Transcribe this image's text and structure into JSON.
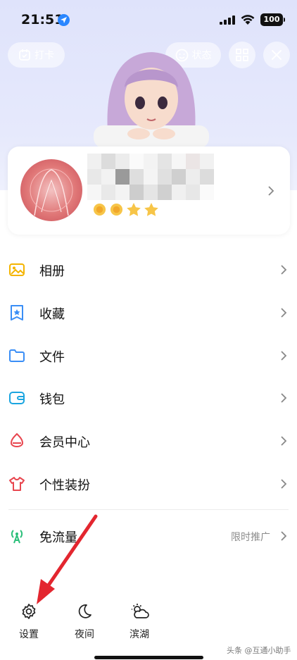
{
  "status_bar": {
    "time": "21:51",
    "battery": "100"
  },
  "top_actions": {
    "checkin_label": "打卡",
    "status_label": "状态"
  },
  "profile": {
    "stars": [
      "sun",
      "sun",
      "star",
      "star"
    ]
  },
  "menu": [
    {
      "label": "相册",
      "icon": "album-icon",
      "color": "#f4b400"
    },
    {
      "label": "收藏",
      "icon": "favorite-icon",
      "color": "#3a8ef6"
    },
    {
      "label": "文件",
      "icon": "folder-icon",
      "color": "#3a8ef6"
    },
    {
      "label": "钱包",
      "icon": "wallet-icon",
      "color": "#1aa5e0"
    },
    {
      "label": "会员中心",
      "icon": "vip-icon",
      "color": "#e8464f"
    },
    {
      "label": "个性装扮",
      "icon": "dress-up-icon",
      "color": "#e8464f"
    }
  ],
  "free_data": {
    "label": "免流量",
    "right_text": "限时推广",
    "color": "#2bbf7a"
  },
  "bottom": {
    "settings": "设置",
    "night": "夜间",
    "weather": "滨湖"
  },
  "watermark": "头条 @互通小助手",
  "colors": {
    "accent_arrow": "#e3262f",
    "hero_bg": "#e2e6fc"
  }
}
